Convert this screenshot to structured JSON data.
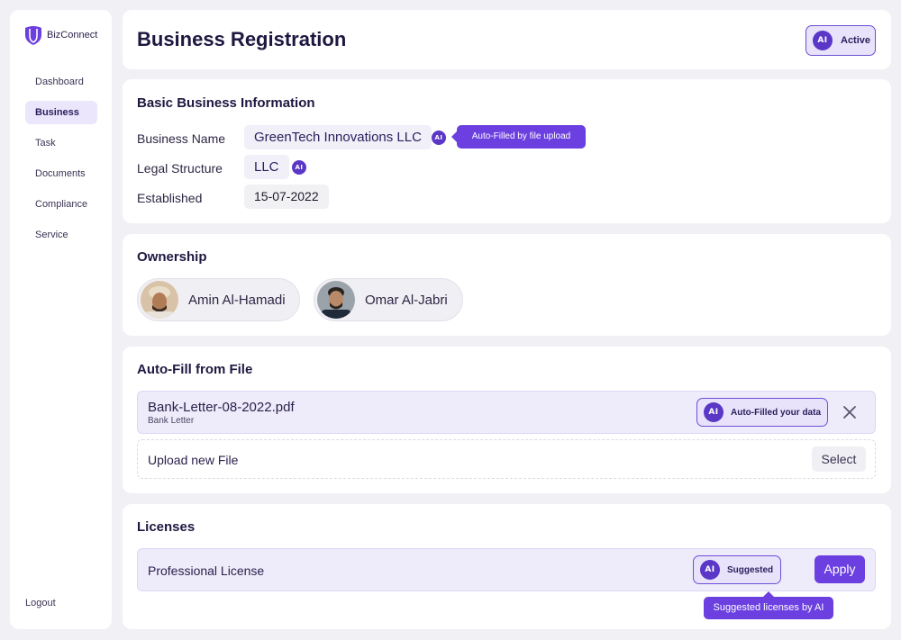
{
  "brand": {
    "name": "BizConnect"
  },
  "sidebar": {
    "items": [
      {
        "label": "Dashboard",
        "active": false
      },
      {
        "label": "Business",
        "active": true
      },
      {
        "label": "Task",
        "active": false
      },
      {
        "label": "Documents",
        "active": false
      },
      {
        "label": "Compliance",
        "active": false
      },
      {
        "label": "Service",
        "active": false
      }
    ],
    "logout_label": "Logout"
  },
  "header": {
    "title": "Business Registration",
    "status": {
      "ai_label": "AI",
      "label": "Active"
    }
  },
  "basic_info": {
    "title": "Basic Business Information",
    "business_name": {
      "label": "Business Name",
      "value": "GreenTech Innovations LLC",
      "ai_label": "AI"
    },
    "legal_structure": {
      "label": "Legal Structure",
      "value": "LLC",
      "ai_label": "AI"
    },
    "established": {
      "label": "Established",
      "value": "15-07-2022"
    },
    "tooltip": "Auto-Filled by file upload"
  },
  "ownership": {
    "title": "Ownership",
    "owners": [
      {
        "name": "Amin Al-Hamadi"
      },
      {
        "name": "Omar Al-Jabri"
      }
    ]
  },
  "autofill": {
    "title": "Auto-Fill from File",
    "file": {
      "name": "Bank-Letter-08-2022.pdf",
      "type": "Bank Letter",
      "ai_label": "AI",
      "status": "Auto-Filled your data"
    },
    "upload": {
      "label": "Upload new File",
      "button": "Select"
    }
  },
  "licenses": {
    "title": "Licenses",
    "item": {
      "label": "Professional License",
      "ai_label": "AI",
      "status": "Suggested",
      "button": "Apply"
    },
    "tooltip": "Suggested licenses by AI"
  },
  "colors": {
    "accent": "#6b3fe0",
    "ai_badge": "#5b37c7",
    "pill_bg": "#e8e3fb",
    "background": "#f1f0f4"
  }
}
